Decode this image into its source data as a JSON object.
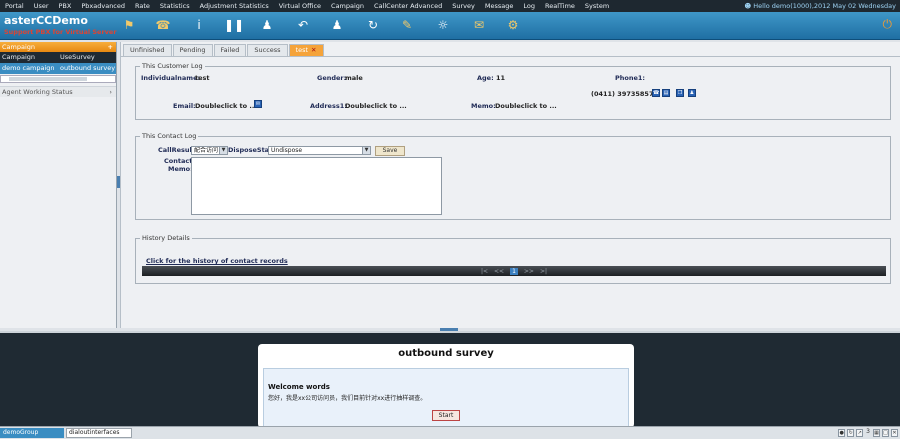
{
  "menu": {
    "items": [
      "Portal",
      "User",
      "PBX",
      "Pbxadvanced",
      "Rate",
      "Statistics",
      "Adjustment Statistics",
      "Virtual Office",
      "Campaign",
      "CallCenter Advanced",
      "Survey",
      "Message",
      "Log",
      "RealTime",
      "System"
    ],
    "hello": "Hello demo(1000),2012 May 02 Wednesday"
  },
  "header": {
    "app_name": "asterCCDemo",
    "subtitle": "Support PBX for Virtual Server"
  },
  "sidebar": {
    "campaign_header": "Campaign",
    "col1": "Campaign",
    "col2": "UseSurvey",
    "row_campaign": "demo campaign",
    "row_survey": "outbound survey",
    "agent_status": "Agent Working Status"
  },
  "tabs": [
    "Unfinished",
    "Pending",
    "Failed",
    "Success",
    "test"
  ],
  "customer_log": {
    "legend": "This Customer Log",
    "individual_label": "Individualname:",
    "individual_value": "test",
    "gender_label": "Gender:",
    "gender_value": "male",
    "age_label": "Age:",
    "age_value": "11",
    "phone_label": "Phone1:",
    "phone_value": "(0411) 39735857",
    "email_label": "Email:",
    "email_value": "Doubleclick to ...",
    "address_label": "Address1:",
    "address_value": "Doubleclick to ...",
    "memo_label": "Memo:",
    "memo_value": "Doubleclick to ..."
  },
  "contact_log": {
    "legend": "This Contact Log",
    "callresult_label": "CallResult:",
    "callresult_value": "配合访问",
    "dispose_label": "DisposeStatus:",
    "dispose_value": "Undispose",
    "save": "Save",
    "memo_label_1": "Contact",
    "memo_label_2": "Memo:"
  },
  "history": {
    "legend": "History Details",
    "link": "Click for the history of contact records",
    "pager": [
      "|<",
      "<<",
      "1",
      ">>",
      ">|"
    ]
  },
  "survey": {
    "title": "outbound survey",
    "welcome_title": "Welcome words",
    "welcome_text": "您好，我是xx公司访问员，我们目前针对xx进行抽样调查。",
    "start": "Start"
  },
  "status": {
    "group": "demoGroup",
    "interfaces": "dialoutinterfaces",
    "count": "3"
  }
}
